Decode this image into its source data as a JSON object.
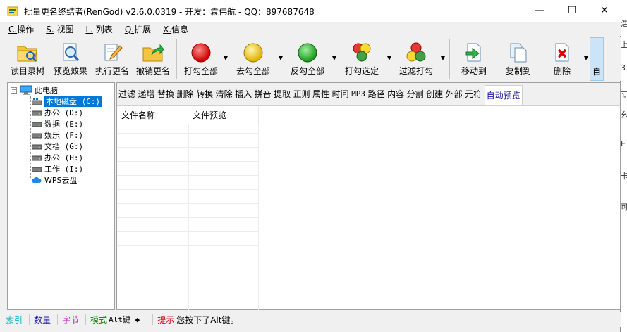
{
  "window": {
    "title": "批量更名终结者(RenGod) v2.6.0.0319 - 开发：袁伟航 - QQ：897687648",
    "controls": {
      "minimize": "—",
      "maximize": "☐",
      "close": "✕"
    }
  },
  "menu": {
    "items": [
      {
        "acc": "C.",
        "label": "操作"
      },
      {
        "acc": "S.",
        "label": " 视图"
      },
      {
        "acc": "L.",
        "label": " 列表"
      },
      {
        "acc": "Q.",
        "label": "扩展"
      },
      {
        "acc": "X.",
        "label": "信息"
      }
    ]
  },
  "toolbar": {
    "read_dir": "读目录树",
    "preview": "预览效果",
    "rename": "执行更名",
    "undo": "撤销更名",
    "check_all": "打勾全部",
    "uncheck_all": "去勾全部",
    "invert_all": "反勾全部",
    "check_selected": "打勾选定",
    "filter_check": "过滤打勾",
    "move_to": "移动到",
    "copy_to": "复制到",
    "delete": "删除",
    "auto": "自"
  },
  "tree": {
    "root": "此电脑",
    "expander": "−",
    "drives": [
      {
        "label": "本地磁盘 (C:)",
        "selected": true
      },
      {
        "label": "办公 (D:)"
      },
      {
        "label": "数据 (E:)"
      },
      {
        "label": "娱乐 (F:)"
      },
      {
        "label": "文档 (G:)"
      },
      {
        "label": "办公 (H:)"
      },
      {
        "label": "工作 (I:)"
      }
    ],
    "cloud": "WPS云盘"
  },
  "tabs": [
    "过滤",
    "递增",
    "替换",
    "删除",
    "转换",
    "清除",
    "插入",
    "拼音",
    "提取",
    "正则",
    "属性",
    "时间",
    "MP3",
    "路径",
    "内容",
    "分割",
    "创建",
    "外部",
    "元符",
    "自动预览"
  ],
  "filelist": {
    "col_name": "文件名称",
    "col_preview": "文件预览"
  },
  "status": {
    "index": "索引",
    "count": "数量",
    "bytes": "字节",
    "mode_label": "模式",
    "mode_value": "Alt键 ◆",
    "hint_label": "提示",
    "hint_text": "您按下了Alt键。"
  },
  "colors": {
    "index": "#00b7c3",
    "count": "#1a1ab0",
    "bytes": "#c000c0",
    "mode": "#008000",
    "hint": "#d00000",
    "selection": "#0078d7"
  },
  "background_chars": [
    "浩",
    "上",
    "3",
    "寸",
    "幺",
    "E",
    "卡",
    "可"
  ]
}
